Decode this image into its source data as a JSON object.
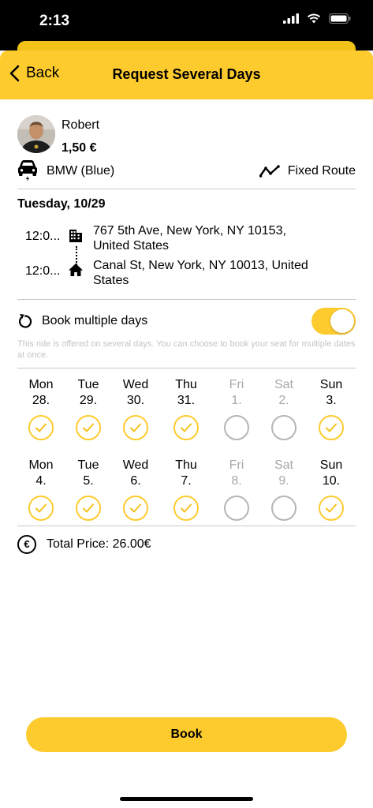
{
  "status_bar": {
    "time": "2:13"
  },
  "nav": {
    "back_label": "Back",
    "title": "Request Several Days"
  },
  "driver": {
    "name": "Robert",
    "price": "1,50 €"
  },
  "car": {
    "label": "BMW (Blue)",
    "route_type": "Fixed Route"
  },
  "trip": {
    "date": "Tuesday, 10/29",
    "origin": {
      "time": "12:0...",
      "address": "767 5th Ave, New York, NY 10153, United States",
      "icon": "building-icon"
    },
    "destination": {
      "time": "12:0...",
      "address": "Canal St, New York, NY 10013, United States",
      "icon": "home-icon"
    }
  },
  "multi_day": {
    "label": "Book multiple days",
    "enabled": true,
    "hint": "This ride is offered on several days. You can choose to book your seat for multiple dates at once."
  },
  "weeks": [
    [
      {
        "name": "Mon",
        "num": "28.",
        "available": true,
        "checked": true
      },
      {
        "name": "Tue",
        "num": "29.",
        "available": true,
        "checked": true
      },
      {
        "name": "Wed",
        "num": "30.",
        "available": true,
        "checked": true
      },
      {
        "name": "Thu",
        "num": "31.",
        "available": true,
        "checked": true
      },
      {
        "name": "Fri",
        "num": "1.",
        "available": false,
        "checked": false
      },
      {
        "name": "Sat",
        "num": "2.",
        "available": false,
        "checked": false
      },
      {
        "name": "Sun",
        "num": "3.",
        "available": true,
        "checked": true
      }
    ],
    [
      {
        "name": "Mon",
        "num": "4.",
        "available": true,
        "checked": true
      },
      {
        "name": "Tue",
        "num": "5.",
        "available": true,
        "checked": true
      },
      {
        "name": "Wed",
        "num": "6.",
        "available": true,
        "checked": true
      },
      {
        "name": "Thu",
        "num": "7.",
        "available": true,
        "checked": true
      },
      {
        "name": "Fri",
        "num": "8.",
        "available": false,
        "checked": false
      },
      {
        "name": "Sat",
        "num": "9.",
        "available": false,
        "checked": false
      },
      {
        "name": "Sun",
        "num": "10.",
        "available": true,
        "checked": true
      }
    ]
  ],
  "total": {
    "label": "Total Price: 26.00€"
  },
  "book": {
    "label": "Book"
  },
  "colors": {
    "accent": "#fecb2e",
    "disabled": "#b5b5b5",
    "divider": "#c9c9c9"
  }
}
